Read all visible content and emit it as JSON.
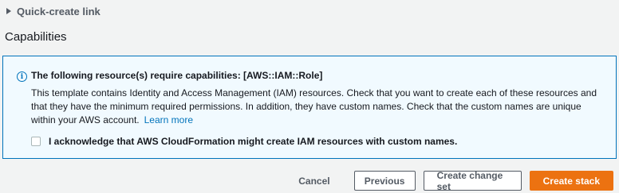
{
  "quick_create": {
    "label": "Quick-create link"
  },
  "capabilities": {
    "title": "Capabilities",
    "info_icon": "info-icon",
    "heading": "The following resource(s) require capabilities: [AWS::IAM::Role]",
    "body": "This template contains Identity and Access Management (IAM) resources. Check that you want to create each of these resources and that they have the minimum required permissions. In addition, they have custom names. Check that the custom names are unique within your AWS account.",
    "learn_more": "Learn more",
    "acknowledge": "I acknowledge that AWS CloudFormation might create IAM resources with custom names.",
    "acknowledge_checked": false
  },
  "actions": {
    "cancel": "Cancel",
    "previous": "Previous",
    "create_change_set": "Create change set",
    "create_stack": "Create stack"
  },
  "colors": {
    "info_border": "#0073bb",
    "info_bg": "#f1faff",
    "primary": "#ec7211",
    "link": "#0073bb"
  }
}
